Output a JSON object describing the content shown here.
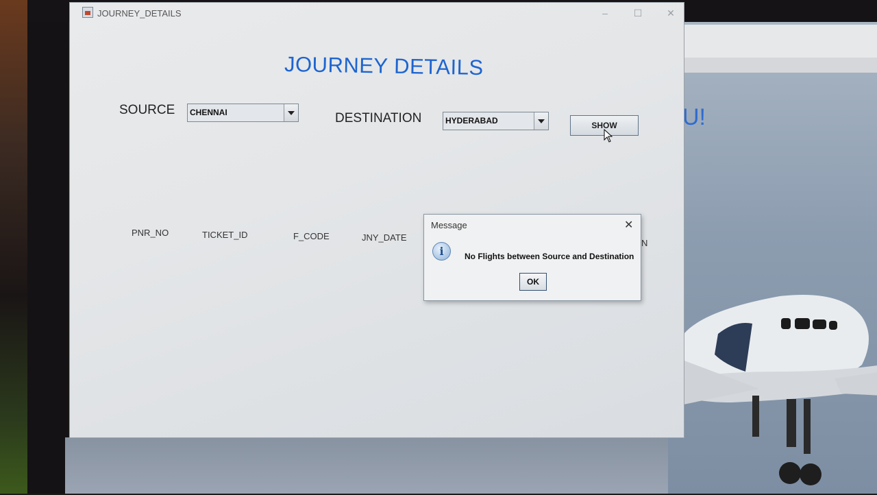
{
  "window": {
    "title": "JOURNEY_DETAILS",
    "minimize": "–",
    "maximize": "☐",
    "close": "✕"
  },
  "heading": "JOURNEY DETAILS",
  "form": {
    "source_label": "SOURCE",
    "source_value": "CHENNAI",
    "destination_label": "DESTINATION",
    "destination_value": "HYDERABAD",
    "show_label": "SHOW"
  },
  "table": {
    "columns": [
      "PNR_NO",
      "TICKET_ID",
      "F_CODE",
      "JNY_DATE",
      "N"
    ]
  },
  "dialog": {
    "title": "Message",
    "close": "✕",
    "icon": "info-icon",
    "icon_glyph": "i",
    "message": "No Flights between Source and Destination",
    "ok_label": "OK"
  },
  "background_window": {
    "partial_text": "U!"
  },
  "colors": {
    "heading": "#1d64d0",
    "dialog_bg": "#f0f1f2",
    "window_bg": "#e6e8ea"
  }
}
